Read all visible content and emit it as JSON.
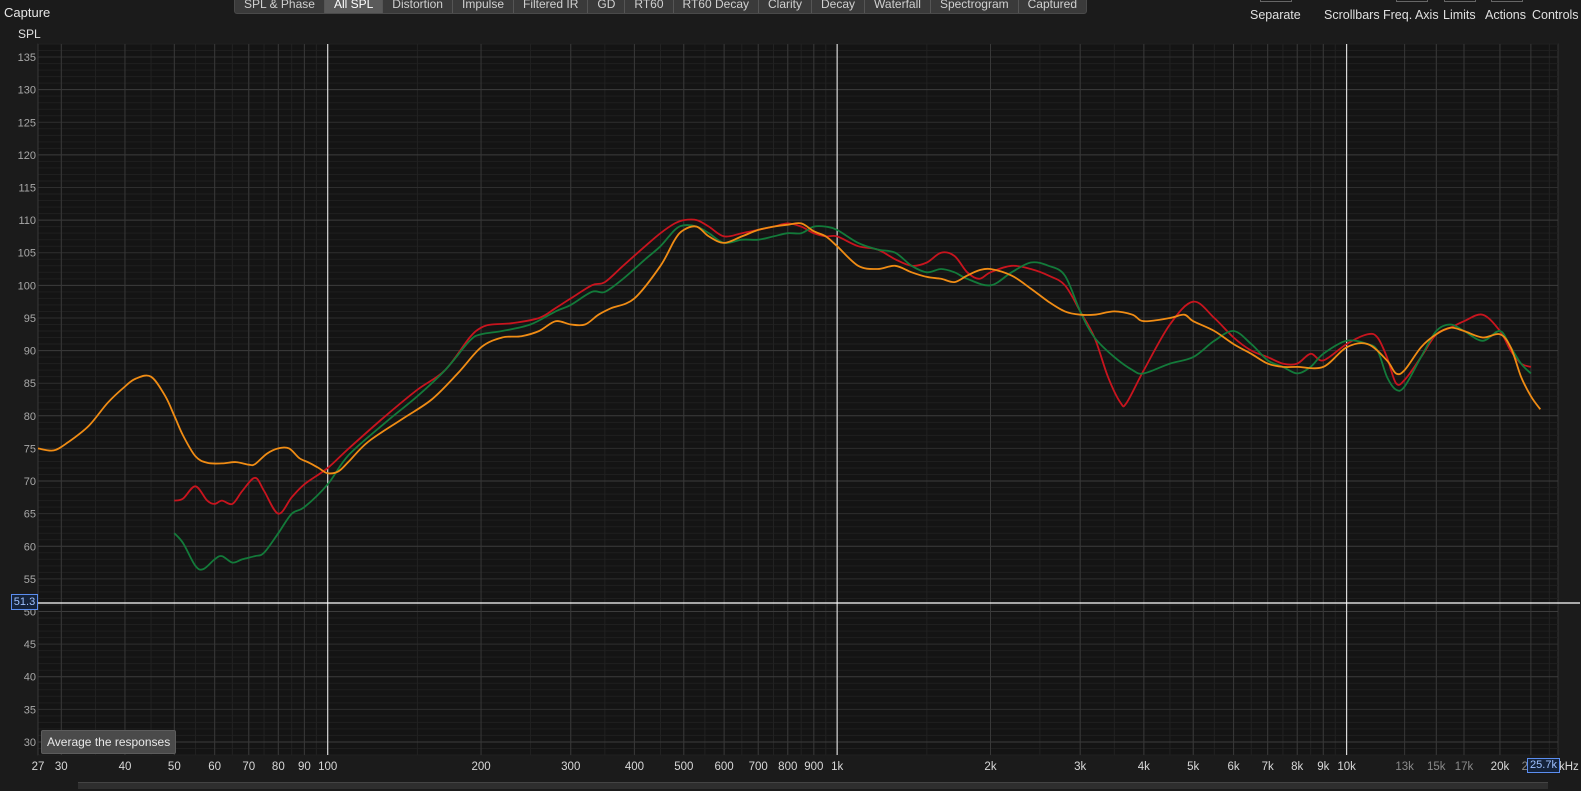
{
  "app": {
    "title": "Capture"
  },
  "tabs": [
    {
      "label": "SPL & Phase",
      "active": false
    },
    {
      "label": "All SPL",
      "active": true
    },
    {
      "label": "Distortion",
      "active": false
    },
    {
      "label": "Impulse",
      "active": false
    },
    {
      "label": "Filtered IR",
      "active": false
    },
    {
      "label": "GD",
      "active": false
    },
    {
      "label": "RT60",
      "active": false
    },
    {
      "label": "RT60 Decay",
      "active": false
    },
    {
      "label": "Clarity",
      "active": false
    },
    {
      "label": "Decay",
      "active": false
    },
    {
      "label": "Waterfall",
      "active": false
    },
    {
      "label": "Spectrogram",
      "active": false
    },
    {
      "label": "Captured",
      "active": false
    }
  ],
  "toolbar": {
    "separate": "Separate",
    "scrollbars": "Scrollbars",
    "freq_axis": "Freq. Axis",
    "limits": "Limits",
    "actions": "Actions",
    "controls": "Controls"
  },
  "average_button": "Average the responses",
  "cursor": {
    "y_value": "51.3",
    "x_value": "25.7k"
  },
  "freq_unit_suffix": "kHz",
  "colors": {
    "background": "#1b1b1b",
    "grid": "#3c3c3c",
    "red": "#c8141e",
    "green": "#137a3a",
    "orange": "#f08c14",
    "cursor": "#ffffff"
  },
  "chart_data": {
    "type": "line",
    "ylabel": "SPL",
    "xscale": "log",
    "xlim": [
      27,
      26000
    ],
    "ylim": [
      28,
      137
    ],
    "y_ticks": [
      30,
      35,
      40,
      45,
      50,
      55,
      60,
      65,
      70,
      75,
      80,
      85,
      90,
      95,
      100,
      105,
      110,
      115,
      120,
      125,
      130,
      135
    ],
    "x_ticks": [
      {
        "v": 27,
        "label": "27"
      },
      {
        "v": 30,
        "label": "30"
      },
      {
        "v": 40,
        "label": "40"
      },
      {
        "v": 50,
        "label": "50"
      },
      {
        "v": 60,
        "label": "60"
      },
      {
        "v": 70,
        "label": "70"
      },
      {
        "v": 80,
        "label": "80"
      },
      {
        "v": 90,
        "label": "90"
      },
      {
        "v": 100,
        "label": "100"
      },
      {
        "v": 200,
        "label": "200"
      },
      {
        "v": 300,
        "label": "300"
      },
      {
        "v": 400,
        "label": "400"
      },
      {
        "v": 500,
        "label": "500"
      },
      {
        "v": 600,
        "label": "600"
      },
      {
        "v": 700,
        "label": "700"
      },
      {
        "v": 800,
        "label": "800"
      },
      {
        "v": 900,
        "label": "900"
      },
      {
        "v": 1000,
        "label": "1k"
      },
      {
        "v": 2000,
        "label": "2k"
      },
      {
        "v": 3000,
        "label": "3k"
      },
      {
        "v": 4000,
        "label": "4k"
      },
      {
        "v": 5000,
        "label": "5k"
      },
      {
        "v": 6000,
        "label": "6k"
      },
      {
        "v": 7000,
        "label": "7k"
      },
      {
        "v": 8000,
        "label": "8k"
      },
      {
        "v": 9000,
        "label": "9k"
      },
      {
        "v": 10000,
        "label": "10k"
      },
      {
        "v": 13000,
        "label": "13k"
      },
      {
        "v": 15000,
        "label": "15k"
      },
      {
        "v": 17000,
        "label": "17k"
      },
      {
        "v": 20000,
        "label": "20k"
      },
      {
        "v": 23000,
        "label": "23k"
      }
    ],
    "cursor_y": 51.3,
    "series": [
      {
        "color": "#c8141e",
        "points": [
          [
            50,
            67
          ],
          [
            52,
            67.3
          ],
          [
            55,
            69.2
          ],
          [
            58,
            67
          ],
          [
            60,
            66.5
          ],
          [
            62,
            67
          ],
          [
            65,
            66.5
          ],
          [
            68,
            68.5
          ],
          [
            72,
            70.5
          ],
          [
            75,
            68.5
          ],
          [
            80,
            65
          ],
          [
            85,
            67.5
          ],
          [
            90,
            69.5
          ],
          [
            100,
            72
          ],
          [
            110,
            75
          ],
          [
            130,
            80
          ],
          [
            150,
            84
          ],
          [
            170,
            87
          ],
          [
            190,
            92
          ],
          [
            200,
            93.5
          ],
          [
            210,
            94
          ],
          [
            230,
            94.2
          ],
          [
            260,
            95
          ],
          [
            280,
            96.5
          ],
          [
            300,
            98
          ],
          [
            330,
            100
          ],
          [
            350,
            100.5
          ],
          [
            380,
            103
          ],
          [
            420,
            106
          ],
          [
            450,
            108
          ],
          [
            480,
            109.5
          ],
          [
            500,
            110
          ],
          [
            530,
            110
          ],
          [
            560,
            109
          ],
          [
            600,
            107.5
          ],
          [
            650,
            108
          ],
          [
            700,
            108.5
          ],
          [
            750,
            109
          ],
          [
            800,
            109.5
          ],
          [
            850,
            109
          ],
          [
            900,
            108
          ],
          [
            950,
            107.5
          ],
          [
            1000,
            107.5
          ],
          [
            1100,
            106
          ],
          [
            1200,
            105.5
          ],
          [
            1300,
            104
          ],
          [
            1400,
            103
          ],
          [
            1500,
            103.5
          ],
          [
            1600,
            105
          ],
          [
            1700,
            104.5
          ],
          [
            1800,
            102
          ],
          [
            1900,
            101
          ],
          [
            2000,
            102
          ],
          [
            2200,
            103
          ],
          [
            2400,
            102.5
          ],
          [
            2600,
            101.5
          ],
          [
            2800,
            100
          ],
          [
            3000,
            96
          ],
          [
            3200,
            92
          ],
          [
            3400,
            86
          ],
          [
            3600,
            82
          ],
          [
            3700,
            82
          ],
          [
            4000,
            87
          ],
          [
            4500,
            94
          ],
          [
            5000,
            97.5
          ],
          [
            5500,
            95
          ],
          [
            6000,
            92
          ],
          [
            6500,
            90
          ],
          [
            7000,
            89
          ],
          [
            7500,
            88
          ],
          [
            8000,
            88
          ],
          [
            8500,
            89.5
          ],
          [
            9000,
            88.5
          ],
          [
            10000,
            91
          ],
          [
            11000,
            92.5
          ],
          [
            11500,
            92
          ],
          [
            12000,
            89
          ],
          [
            12500,
            85
          ],
          [
            13000,
            85.5
          ],
          [
            14000,
            89
          ],
          [
            15000,
            92.5
          ],
          [
            16000,
            93.5
          ],
          [
            17000,
            94.5
          ],
          [
            18500,
            95.5
          ],
          [
            20000,
            93
          ],
          [
            21000,
            90
          ],
          [
            22000,
            88
          ],
          [
            23000,
            87.5
          ]
        ]
      },
      {
        "color": "#137a3a",
        "points": [
          [
            50,
            62
          ],
          [
            52,
            60.5
          ],
          [
            55,
            57
          ],
          [
            57,
            56.5
          ],
          [
            60,
            58
          ],
          [
            62,
            58.5
          ],
          [
            65,
            57.5
          ],
          [
            68,
            58
          ],
          [
            72,
            58.5
          ],
          [
            75,
            59
          ],
          [
            80,
            62
          ],
          [
            85,
            65
          ],
          [
            90,
            66
          ],
          [
            100,
            69.5
          ],
          [
            110,
            74
          ],
          [
            130,
            79
          ],
          [
            150,
            83
          ],
          [
            170,
            87
          ],
          [
            190,
            91.5
          ],
          [
            200,
            92.5
          ],
          [
            220,
            93
          ],
          [
            250,
            94
          ],
          [
            280,
            96
          ],
          [
            300,
            97
          ],
          [
            330,
            99
          ],
          [
            350,
            99
          ],
          [
            380,
            101
          ],
          [
            420,
            104
          ],
          [
            450,
            106
          ],
          [
            480,
            108.5
          ],
          [
            500,
            109.2
          ],
          [
            530,
            109
          ],
          [
            560,
            108
          ],
          [
            600,
            106.5
          ],
          [
            650,
            107
          ],
          [
            700,
            107
          ],
          [
            750,
            107.5
          ],
          [
            800,
            108
          ],
          [
            850,
            108
          ],
          [
            900,
            109
          ],
          [
            950,
            109
          ],
          [
            1000,
            108.5
          ],
          [
            1100,
            106.5
          ],
          [
            1200,
            105.5
          ],
          [
            1300,
            105
          ],
          [
            1400,
            103
          ],
          [
            1500,
            102
          ],
          [
            1600,
            102.5
          ],
          [
            1700,
            102
          ],
          [
            1800,
            101
          ],
          [
            2000,
            100
          ],
          [
            2200,
            102
          ],
          [
            2400,
            103.5
          ],
          [
            2600,
            103
          ],
          [
            2800,
            101.5
          ],
          [
            3000,
            96
          ],
          [
            3200,
            92
          ],
          [
            3500,
            89
          ],
          [
            3800,
            87
          ],
          [
            4000,
            86.5
          ],
          [
            4500,
            88
          ],
          [
            5000,
            89
          ],
          [
            5500,
            91.5
          ],
          [
            6000,
            93
          ],
          [
            6500,
            91
          ],
          [
            7000,
            88.5
          ],
          [
            7500,
            87.5
          ],
          [
            8000,
            86.5
          ],
          [
            8500,
            87.5
          ],
          [
            9000,
            89.5
          ],
          [
            10000,
            91.5
          ],
          [
            11000,
            91
          ],
          [
            11500,
            90
          ],
          [
            12000,
            86
          ],
          [
            12500,
            84
          ],
          [
            13000,
            84.5
          ],
          [
            14000,
            89
          ],
          [
            15000,
            93
          ],
          [
            16000,
            94
          ],
          [
            17000,
            93
          ],
          [
            18500,
            91.5
          ],
          [
            20000,
            93
          ],
          [
            21000,
            90.5
          ],
          [
            22000,
            88
          ],
          [
            23000,
            86.5
          ]
        ]
      },
      {
        "color": "#f08c14",
        "points": [
          [
            27,
            75
          ],
          [
            29,
            74.7
          ],
          [
            31,
            76
          ],
          [
            34,
            78.5
          ],
          [
            37,
            82
          ],
          [
            40,
            84.5
          ],
          [
            42,
            85.7
          ],
          [
            45,
            86
          ],
          [
            48,
            83
          ],
          [
            50,
            80
          ],
          [
            52,
            77
          ],
          [
            55,
            73.8
          ],
          [
            58,
            72.8
          ],
          [
            62,
            72.7
          ],
          [
            66,
            72.9
          ],
          [
            70,
            72.5
          ],
          [
            72,
            72.6
          ],
          [
            76,
            74.2
          ],
          [
            80,
            75
          ],
          [
            84,
            75
          ],
          [
            88,
            73.5
          ],
          [
            92,
            72.8
          ],
          [
            96,
            72
          ],
          [
            100,
            71.2
          ],
          [
            105,
            71.5
          ],
          [
            110,
            73
          ],
          [
            120,
            76
          ],
          [
            140,
            79.5
          ],
          [
            160,
            82.5
          ],
          [
            180,
            86.5
          ],
          [
            200,
            90.5
          ],
          [
            220,
            92
          ],
          [
            240,
            92.2
          ],
          [
            260,
            93
          ],
          [
            280,
            94.5
          ],
          [
            300,
            94
          ],
          [
            320,
            94
          ],
          [
            340,
            95.5
          ],
          [
            360,
            96.5
          ],
          [
            400,
            98
          ],
          [
            450,
            103
          ],
          [
            480,
            107
          ],
          [
            500,
            108.5
          ],
          [
            530,
            109
          ],
          [
            560,
            107.5
          ],
          [
            600,
            106.5
          ],
          [
            650,
            107.5
          ],
          [
            700,
            108.5
          ],
          [
            750,
            109
          ],
          [
            800,
            109.3
          ],
          [
            850,
            109.5
          ],
          [
            900,
            108.3
          ],
          [
            950,
            107.5
          ],
          [
            1000,
            106
          ],
          [
            1100,
            103
          ],
          [
            1200,
            102.5
          ],
          [
            1300,
            103
          ],
          [
            1400,
            102
          ],
          [
            1500,
            101.3
          ],
          [
            1600,
            101
          ],
          [
            1700,
            100.5
          ],
          [
            1800,
            101.5
          ],
          [
            1900,
            102.3
          ],
          [
            2000,
            102.5
          ],
          [
            2200,
            101.5
          ],
          [
            2400,
            99.5
          ],
          [
            2600,
            97.5
          ],
          [
            2800,
            96
          ],
          [
            3000,
            95.5
          ],
          [
            3200,
            95.5
          ],
          [
            3500,
            96
          ],
          [
            3800,
            95.5
          ],
          [
            4000,
            94.5
          ],
          [
            4500,
            95
          ],
          [
            4800,
            95.5
          ],
          [
            5000,
            94.5
          ],
          [
            5500,
            93
          ],
          [
            6000,
            91
          ],
          [
            6500,
            89.5
          ],
          [
            7000,
            88
          ],
          [
            7500,
            87.5
          ],
          [
            8000,
            87.5
          ],
          [
            9000,
            87.5
          ],
          [
            10000,
            90.5
          ],
          [
            11000,
            91
          ],
          [
            12000,
            88.5
          ],
          [
            12500,
            86.5
          ],
          [
            13000,
            87
          ],
          [
            14000,
            90.5
          ],
          [
            15000,
            92.5
          ],
          [
            16000,
            93.5
          ],
          [
            17000,
            93
          ],
          [
            18500,
            92
          ],
          [
            20000,
            92.5
          ],
          [
            21000,
            90.5
          ],
          [
            22000,
            86
          ],
          [
            23000,
            83
          ],
          [
            24000,
            81
          ]
        ]
      }
    ]
  }
}
